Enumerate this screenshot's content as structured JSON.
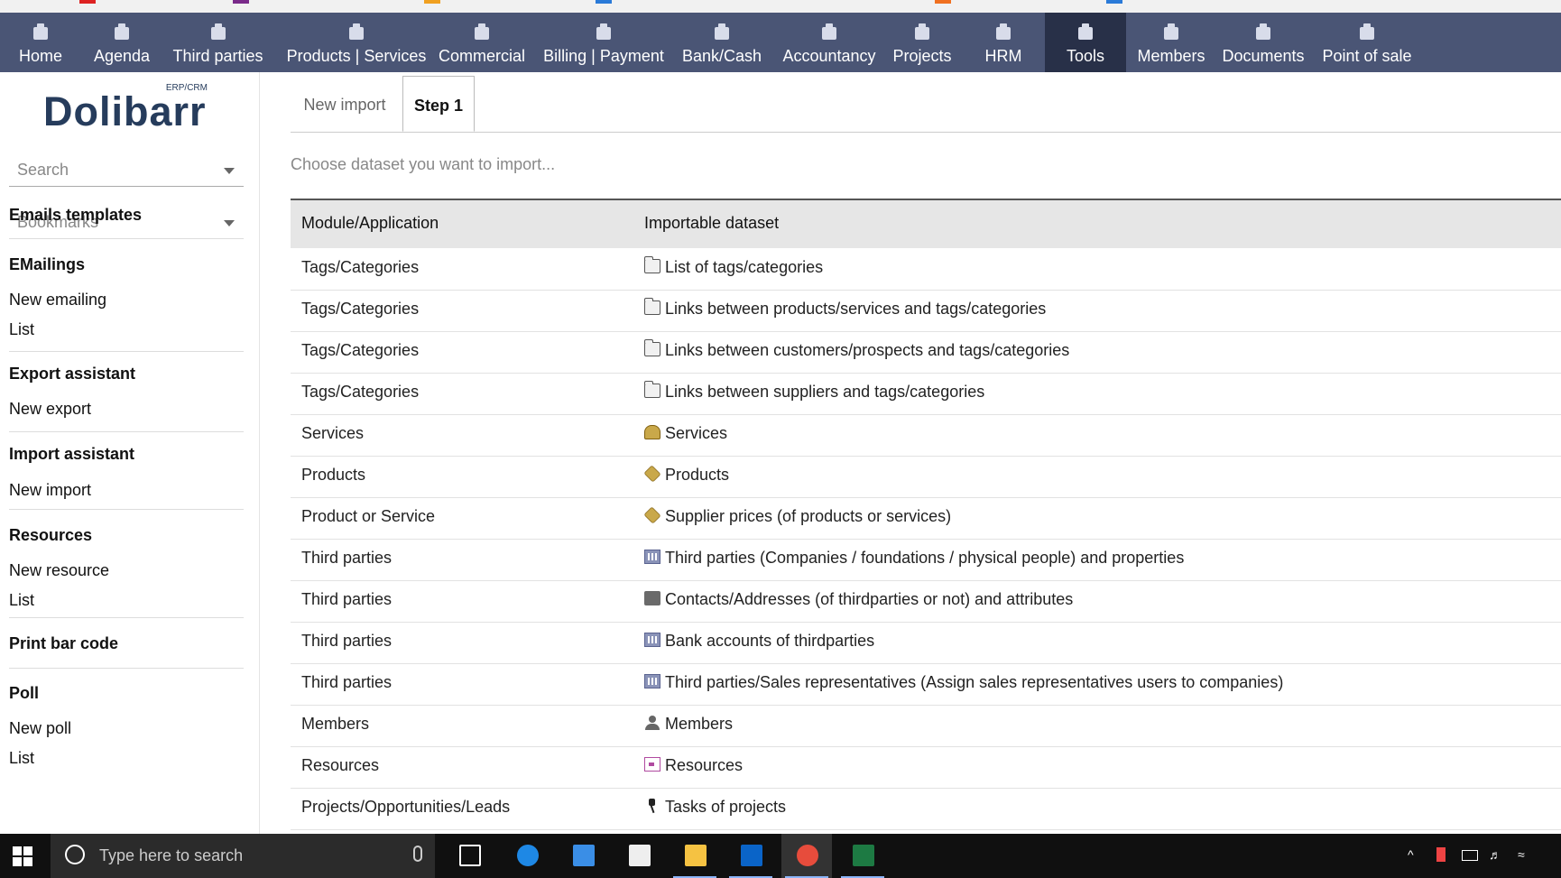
{
  "top_menu": [
    {
      "label": "Home",
      "icon": "home-icon"
    },
    {
      "label": "Agenda",
      "icon": "agenda-icon"
    },
    {
      "label": "Third parties",
      "icon": "building-icon"
    },
    {
      "label": "Products | Services",
      "icon": "product-icon"
    },
    {
      "label": "Commercial",
      "icon": "commercial-icon"
    },
    {
      "label": "Billing | Payment",
      "icon": "billing-icon"
    },
    {
      "label": "Bank/Cash",
      "icon": "bank-icon"
    },
    {
      "label": "Accountancy",
      "icon": "accountancy-icon"
    },
    {
      "label": "Projects",
      "icon": "projects-icon"
    },
    {
      "label": "HRM",
      "icon": "hrm-icon"
    },
    {
      "label": "Tools",
      "icon": "tools-icon",
      "active": true
    },
    {
      "label": "Members",
      "icon": "members-icon"
    },
    {
      "label": "Documents",
      "icon": "documents-icon"
    },
    {
      "label": "Point of sale",
      "icon": "pos-icon"
    }
  ],
  "logo": {
    "name": "Dolibarr",
    "sub": "ERP/CRM"
  },
  "sidebar": {
    "search_label": "Search",
    "bookmarks_label": "Bookmarks",
    "sections": [
      {
        "title": "Emails templates",
        "links": []
      },
      {
        "title": "EMailings",
        "links": [
          "New emailing",
          "List"
        ]
      },
      {
        "title": "Export assistant",
        "links": [
          "New export"
        ]
      },
      {
        "title": "Import assistant",
        "links": [
          "New import"
        ]
      },
      {
        "title": "Resources",
        "links": [
          "New resource",
          "List"
        ]
      },
      {
        "title": "Print bar code",
        "links": []
      },
      {
        "title": "Poll",
        "links": [
          "New poll",
          "List"
        ]
      }
    ]
  },
  "tabs": [
    {
      "label": "New import",
      "active": false
    },
    {
      "label": "Step 1",
      "active": true
    }
  ],
  "instruction": "Choose dataset you want to import...",
  "table": {
    "headers": [
      "Module/Application",
      "Importable dataset"
    ],
    "rows": [
      {
        "module": "Tags/Categories",
        "dataset": "List of tags/categories",
        "icon": "folder-icon"
      },
      {
        "module": "Tags/Categories",
        "dataset": "Links between products/services and tags/categories",
        "icon": "folder-icon"
      },
      {
        "module": "Tags/Categories",
        "dataset": "Links between customers/prospects and tags/categories",
        "icon": "folder-icon"
      },
      {
        "module": "Tags/Categories",
        "dataset": "Links between suppliers and tags/categories",
        "icon": "folder-icon"
      },
      {
        "module": "Services",
        "dataset": "Services",
        "icon": "service-icon"
      },
      {
        "module": "Products",
        "dataset": "Products",
        "icon": "product-box-icon"
      },
      {
        "module": "Product or Service",
        "dataset": "Supplier prices (of products or services)",
        "icon": "product-box-icon"
      },
      {
        "module": "Third parties",
        "dataset": "Third parties (Companies / foundations / physical people) and properties",
        "icon": "company-icon"
      },
      {
        "module": "Third parties",
        "dataset": "Contacts/Addresses (of thirdparties or not) and attributes",
        "icon": "contact-icon"
      },
      {
        "module": "Third parties",
        "dataset": "Bank accounts of thirdparties",
        "icon": "company-icon"
      },
      {
        "module": "Third parties",
        "dataset": "Third parties/Sales representatives (Assign sales representatives users to companies)",
        "icon": "company-icon"
      },
      {
        "module": "Members",
        "dataset": "Members",
        "icon": "member-icon"
      },
      {
        "module": "Resources",
        "dataset": "Resources",
        "icon": "resource-icon"
      },
      {
        "module": "Projects/Opportunities/Leads",
        "dataset": "Tasks of projects",
        "icon": "pin-icon"
      }
    ]
  },
  "taskbar": {
    "search_placeholder": "Type here to search",
    "apps": [
      "task-view",
      "edge",
      "store",
      "mail",
      "file-explorer",
      "outlook",
      "chrome",
      "excel"
    ]
  },
  "colors": {
    "topmenu_bg": "#4a5575",
    "topmenu_active": "#283048",
    "logo": "#263c5c"
  }
}
